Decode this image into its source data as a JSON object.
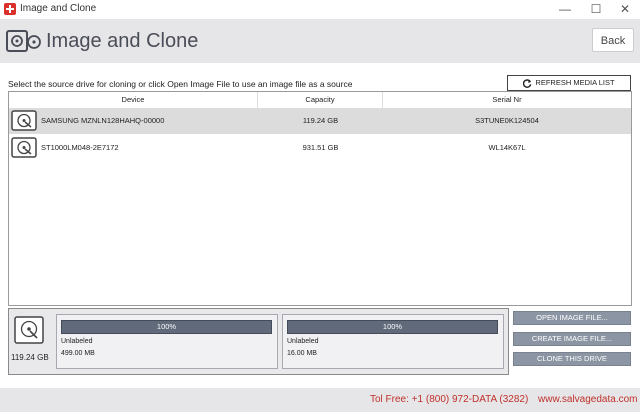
{
  "window": {
    "title": "Image and Clone",
    "controls": [
      "—",
      "☐",
      "✕"
    ]
  },
  "header": {
    "title": "Image and Clone",
    "back_label": "Back"
  },
  "instructions": "Select the source drive for cloning or click Open Image File to use an image file as a source",
  "refresh_label": "REFRESH MEDIA LIST",
  "table": {
    "columns": [
      "Device",
      "Capacity",
      "Serial Nr"
    ],
    "rows": [
      {
        "device": "SAMSUNG MZNLN128HAHQ-00000",
        "capacity": "119.24 GB",
        "serial": "S3TUNE0K124504",
        "selected": true
      },
      {
        "device": "ST1000LM048-2E7172",
        "capacity": "931.51 GB",
        "serial": "WL14K67L",
        "selected": false
      }
    ]
  },
  "selected_drive": {
    "capacity": "119.24 GB",
    "partitions": [
      {
        "progress_label": "100%",
        "progress": 1.0,
        "name": "Unlabeled",
        "size": "499.00 MB"
      },
      {
        "progress_label": "100%",
        "progress": 1.0,
        "name": "Unlabeled",
        "size": "16.00 MB"
      }
    ]
  },
  "actions": {
    "open_image": "OPEN IMAGE FILE...",
    "create_image": "CREATE IMAGE FILE...",
    "clone_drive": "CLONE THIS DRIVE"
  },
  "footer": {
    "toll_free": "Tol Free: +1 (800) 972-DATA (3282)",
    "website": "www.salvagedata.com"
  },
  "colors": {
    "accent_red": "#c0302a",
    "header_bg": "#e6e6e9",
    "button_gray": "#8c95a3",
    "progress_fill": "#606a7a"
  }
}
